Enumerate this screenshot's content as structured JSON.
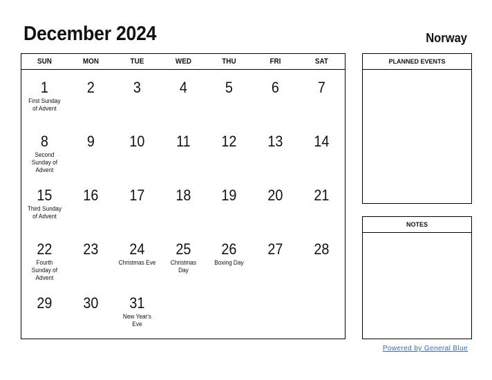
{
  "header": {
    "title": "December 2024",
    "country": "Norway"
  },
  "calendar": {
    "weekdays": [
      "SUN",
      "MON",
      "TUE",
      "WED",
      "THU",
      "FRI",
      "SAT"
    ],
    "weeks": [
      [
        {
          "day": "1",
          "holiday": "First Sunday of Advent"
        },
        {
          "day": "2",
          "holiday": ""
        },
        {
          "day": "3",
          "holiday": ""
        },
        {
          "day": "4",
          "holiday": ""
        },
        {
          "day": "5",
          "holiday": ""
        },
        {
          "day": "6",
          "holiday": ""
        },
        {
          "day": "7",
          "holiday": ""
        }
      ],
      [
        {
          "day": "8",
          "holiday": "Second Sunday of Advent"
        },
        {
          "day": "9",
          "holiday": ""
        },
        {
          "day": "10",
          "holiday": ""
        },
        {
          "day": "11",
          "holiday": ""
        },
        {
          "day": "12",
          "holiday": ""
        },
        {
          "day": "13",
          "holiday": ""
        },
        {
          "day": "14",
          "holiday": ""
        }
      ],
      [
        {
          "day": "15",
          "holiday": "Third Sunday of Advent"
        },
        {
          "day": "16",
          "holiday": ""
        },
        {
          "day": "17",
          "holiday": ""
        },
        {
          "day": "18",
          "holiday": ""
        },
        {
          "day": "19",
          "holiday": ""
        },
        {
          "day": "20",
          "holiday": ""
        },
        {
          "day": "21",
          "holiday": ""
        }
      ],
      [
        {
          "day": "22",
          "holiday": "Fourth Sunday of Advent"
        },
        {
          "day": "23",
          "holiday": ""
        },
        {
          "day": "24",
          "holiday": "Christmas Eve"
        },
        {
          "day": "25",
          "holiday": "Christmas Day"
        },
        {
          "day": "26",
          "holiday": "Boxing Day"
        },
        {
          "day": "27",
          "holiday": ""
        },
        {
          "day": "28",
          "holiday": ""
        }
      ],
      [
        {
          "day": "29",
          "holiday": ""
        },
        {
          "day": "30",
          "holiday": ""
        },
        {
          "day": "31",
          "holiday": "New Year's Eve"
        },
        {
          "day": "",
          "holiday": ""
        },
        {
          "day": "",
          "holiday": ""
        },
        {
          "day": "",
          "holiday": ""
        },
        {
          "day": "",
          "holiday": ""
        }
      ]
    ]
  },
  "sidebar": {
    "planned_events_label": "PLANNED EVENTS",
    "notes_label": "NOTES"
  },
  "footer": {
    "powered_by": "Powered by General Blue"
  }
}
